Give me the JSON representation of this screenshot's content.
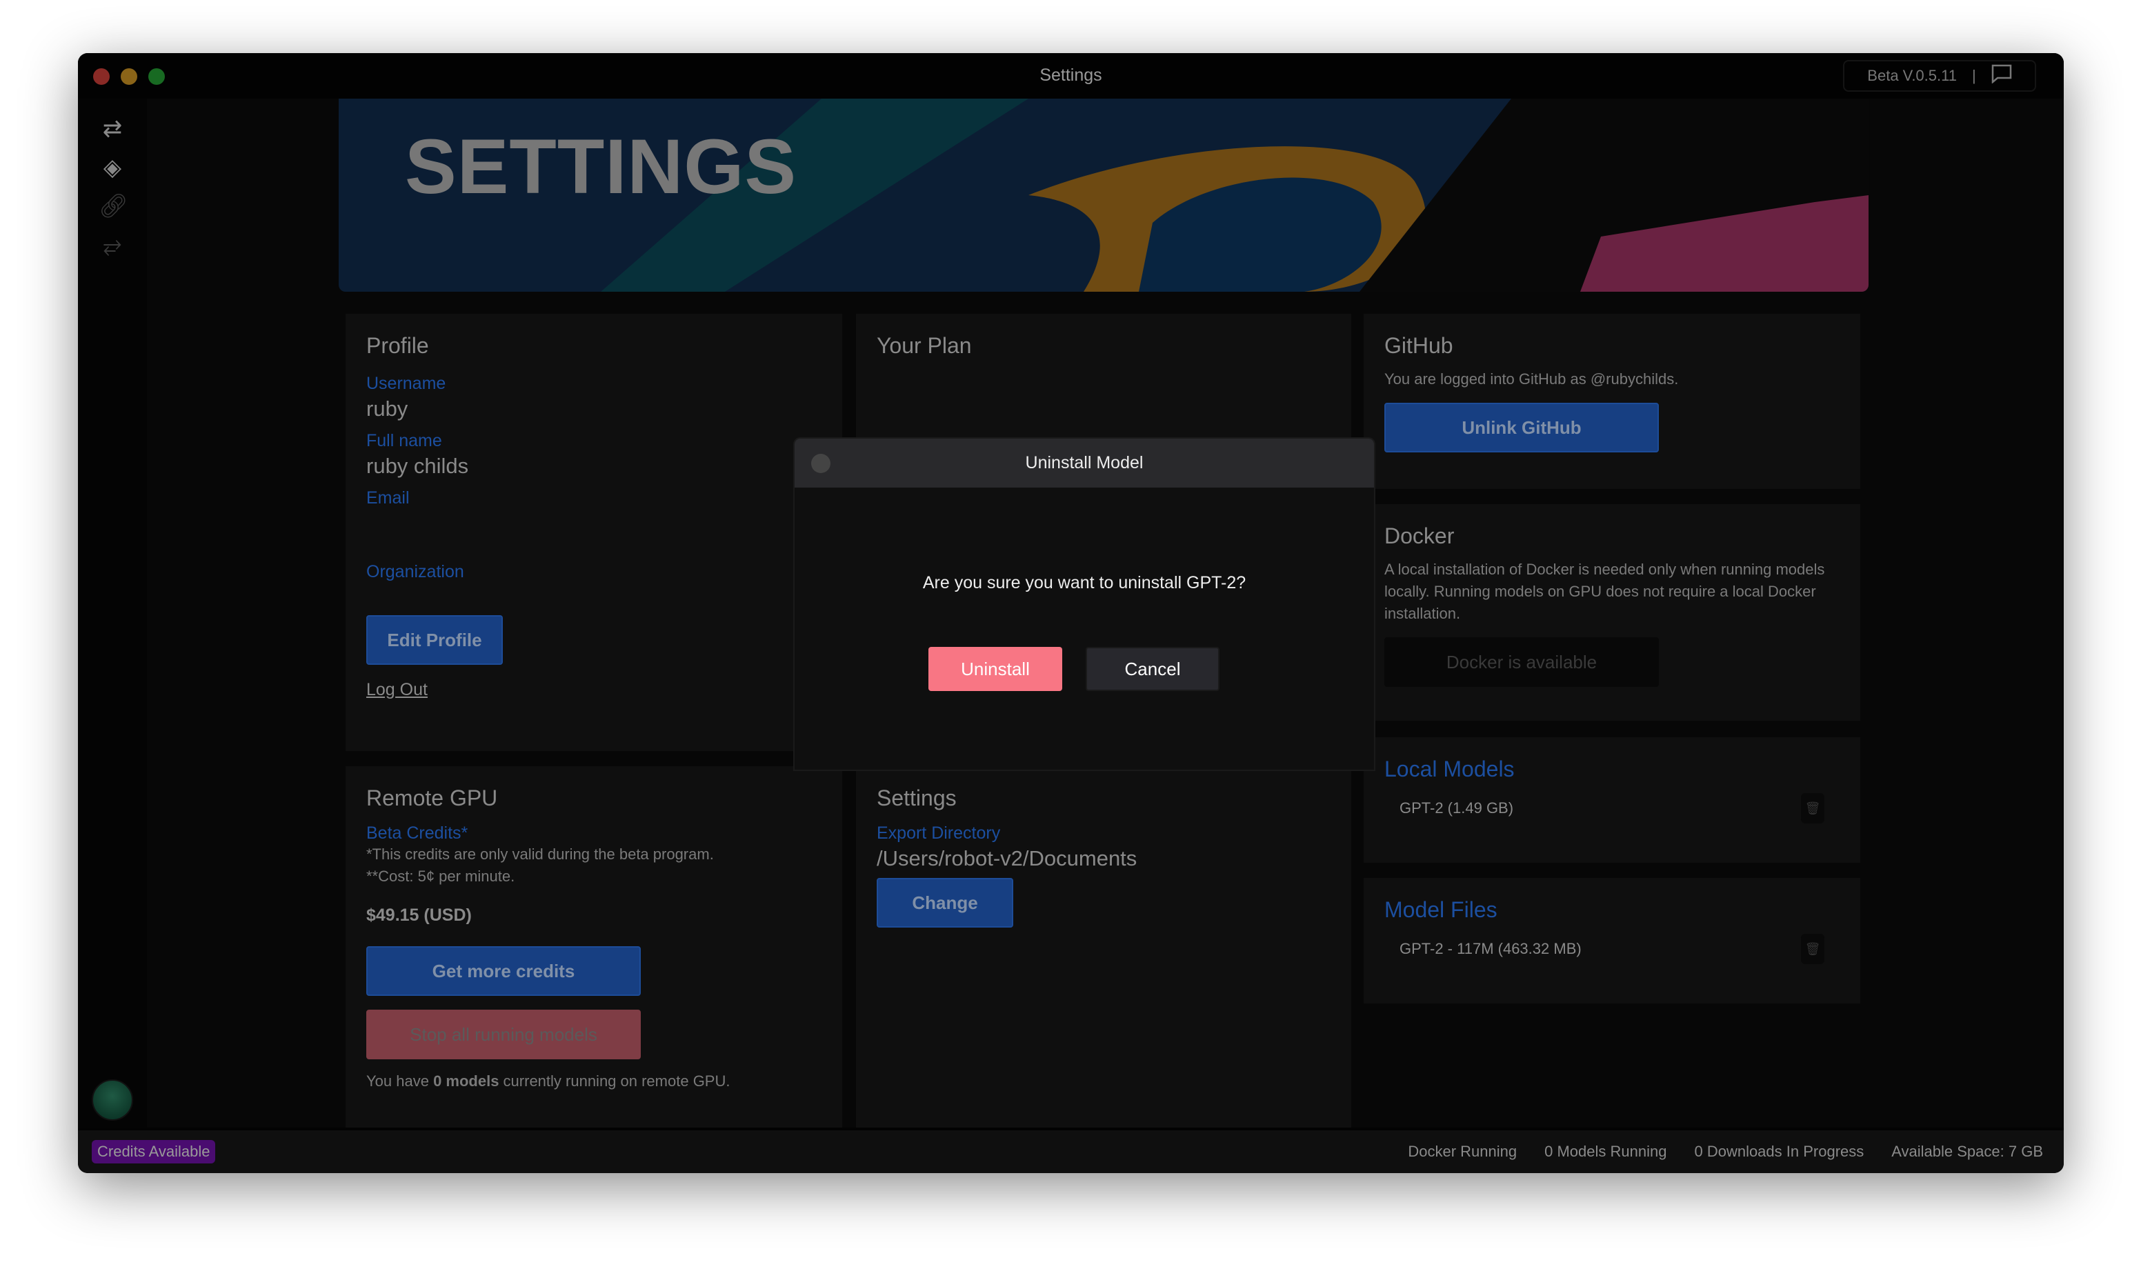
{
  "window": {
    "title": "Settings",
    "version": "Beta V.0.5.11",
    "separator": "|"
  },
  "sidebar": {
    "icons": [
      "swap-arrows-icon",
      "layers-icon",
      "link-icon",
      "route-icon"
    ]
  },
  "banner": {
    "title": "SETTINGS"
  },
  "profile": {
    "title": "Profile",
    "username_label": "Username",
    "username": "ruby",
    "fullname_label": "Full name",
    "fullname": "ruby childs",
    "email_label": "Email",
    "email": "",
    "org_label": "Organization",
    "org": "",
    "edit_button": "Edit Profile",
    "logout": "Log Out"
  },
  "plan": {
    "title": "Your Plan"
  },
  "github": {
    "title": "GitHub",
    "text": "You are logged into GitHub as @rubychilds.",
    "button": "Unlink GitHub"
  },
  "docker": {
    "title": "Docker",
    "text": "A local installation of Docker is needed only when running models locally. Running models on GPU does not require a local Docker installation.",
    "button": "Docker is available"
  },
  "local_models": {
    "title": "Local Models",
    "items": [
      "GPT-2 (1.49 GB)"
    ]
  },
  "model_files": {
    "title": "Model Files",
    "items": [
      "GPT-2 - 117M (463.32 MB)"
    ]
  },
  "remote_gpu": {
    "title": "Remote GPU",
    "credits_label": "Beta Credits*",
    "note1": "*This credits are only valid during the beta program.",
    "note2": "**Cost: 5¢ per minute.",
    "amount": "$49.15 (USD)",
    "more_button": "Get more credits",
    "stop_button": "Stop all running models",
    "running_pre": "You have ",
    "running_bold": "0 models",
    "running_post": " currently running on remote GPU."
  },
  "settings": {
    "title": "Settings",
    "export_label": "Export Directory",
    "export_path": "/Users/robot-v2/Documents",
    "change_button": "Change"
  },
  "statusbar": {
    "badge": "Credits Available",
    "docker": "Docker Running",
    "models": "0 Models Running",
    "downloads": "0 Downloads In Progress",
    "space": "Available Space: 7 GB"
  },
  "modal": {
    "title": "Uninstall Model",
    "question": "Are you sure you want to uninstall GPT-2?",
    "confirm": "Uninstall",
    "cancel": "Cancel"
  },
  "colors": {
    "accent": "#2e7cf6",
    "danger": "#f87684",
    "badge": "#8a14d8"
  }
}
